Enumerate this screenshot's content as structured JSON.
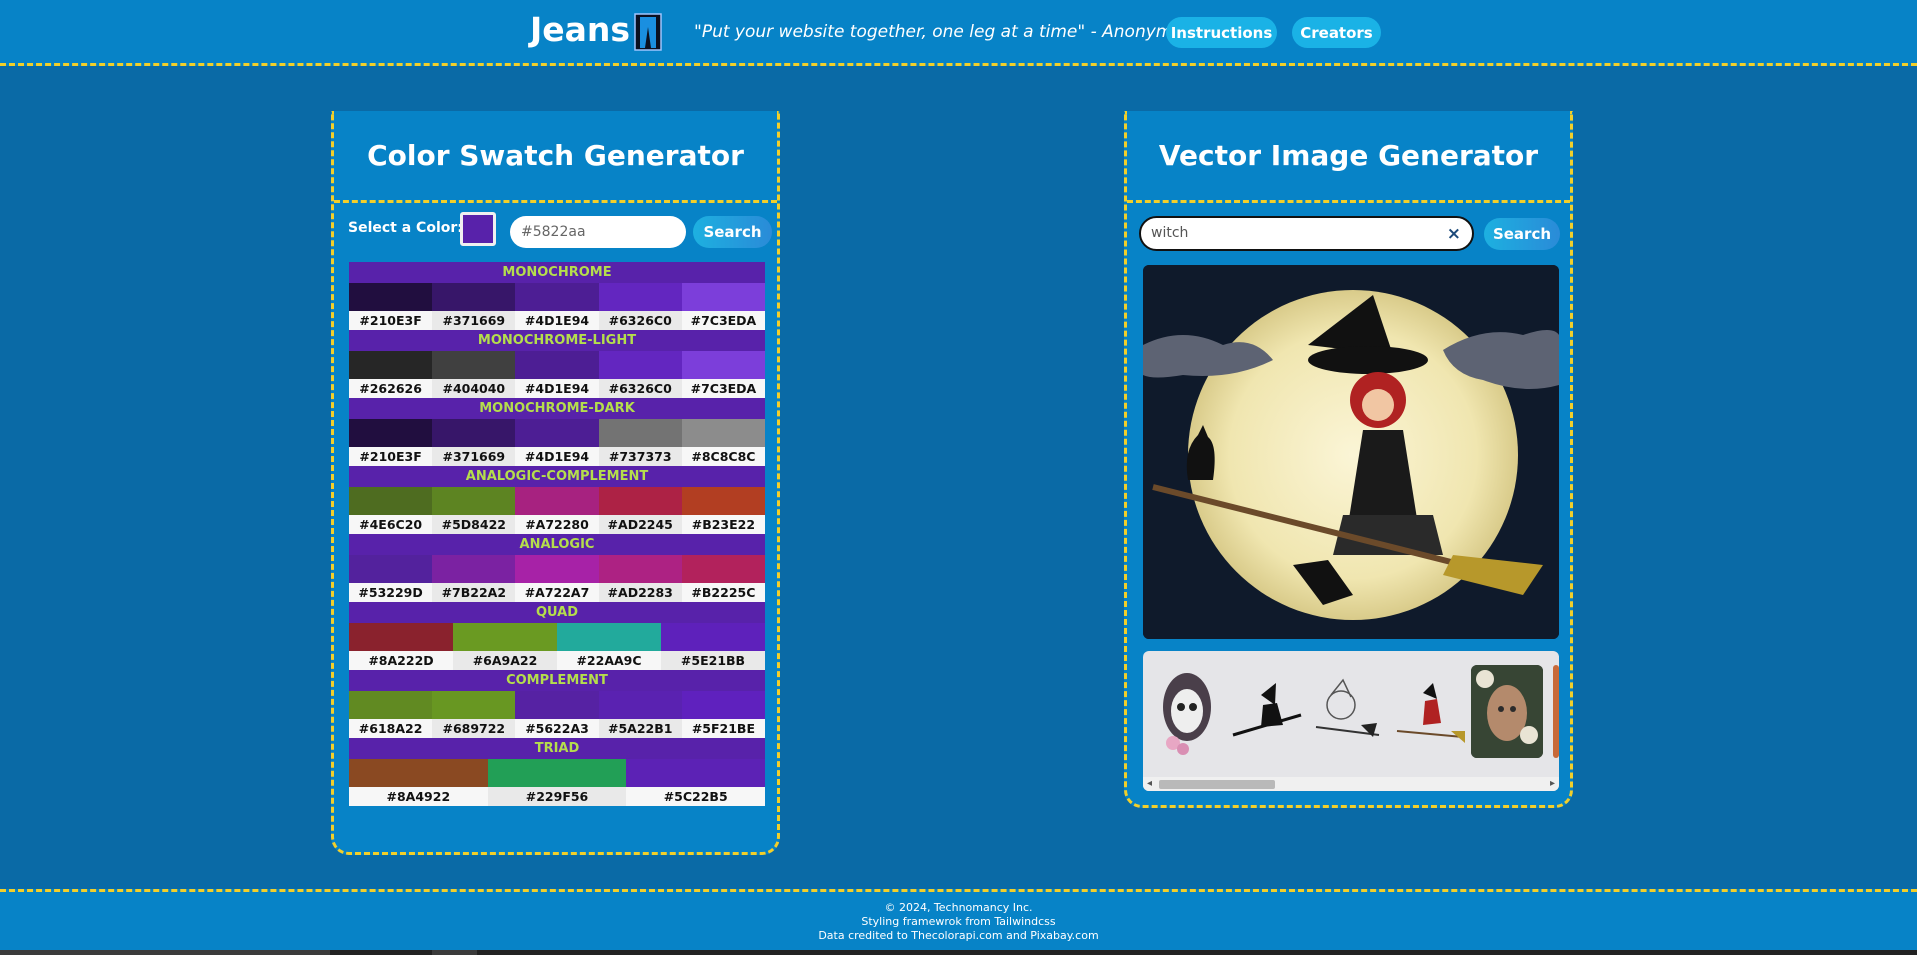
{
  "header": {
    "brand": "Jeans",
    "tagline": "\"Put your website together, one leg at a time\" - Anonymous",
    "nav": [
      "Instructions",
      "Creators"
    ]
  },
  "colors": {
    "background": "#0a6aa6",
    "panel": "#0783c7",
    "dashed_border": "#f2cf2a",
    "accent_button": "#1ab2e6",
    "scheme_title_text": "#b5de4c"
  },
  "color_panel": {
    "title": "Color Swatch Generator",
    "select_label": "Select a Color:",
    "selected_color": "#5822aa",
    "hex_input_value": "#5822aa",
    "search_label": "Search",
    "schemes": [
      {
        "name": "MONOCHROME",
        "colors": [
          "#210E3F",
          "#371669",
          "#4D1E94",
          "#6326C0",
          "#7C3EDA"
        ]
      },
      {
        "name": "MONOCHROME-LIGHT",
        "colors": [
          "#262626",
          "#404040",
          "#4D1E94",
          "#6326C0",
          "#7C3EDA"
        ]
      },
      {
        "name": "MONOCHROME-DARK",
        "colors": [
          "#210E3F",
          "#371669",
          "#4D1E94",
          "#737373",
          "#8C8C8C"
        ]
      },
      {
        "name": "ANALOGIC-COMPLEMENT",
        "colors": [
          "#4E6C20",
          "#5D8422",
          "#A72280",
          "#AD2245",
          "#B23E22"
        ]
      },
      {
        "name": "ANALOGIC",
        "colors": [
          "#53229D",
          "#7B22A2",
          "#A722A7",
          "#AD2283",
          "#B2225C"
        ]
      },
      {
        "name": "QUAD",
        "colors": [
          "#8A222D",
          "#6A9A22",
          "#22AA9C",
          "#5E21BB"
        ]
      },
      {
        "name": "COMPLEMENT",
        "colors": [
          "#618A22",
          "#689722",
          "#5622A3",
          "#5A22B1",
          "#5F21BE"
        ]
      },
      {
        "name": "TRIAD",
        "colors": [
          "#8A4922",
          "#229F56",
          "#5C22B5"
        ]
      }
    ]
  },
  "vector_panel": {
    "title": "Vector Image Generator",
    "search_value": "witch",
    "clear_icon": "close-icon",
    "search_label": "Search",
    "main_image": "witch-on-broom-moon-image",
    "thumbnails": [
      "sugar-skull-woman",
      "witch-silhouette",
      "witch-sketch",
      "witch-on-broom",
      "flower-face-woman"
    ]
  },
  "footer": {
    "copyright": "© 2024, Technomancy Inc.",
    "styling": "Styling framewrok from Tailwindcss",
    "credits": "Data credited to Thecolorapi.com and Pixabay.com"
  }
}
